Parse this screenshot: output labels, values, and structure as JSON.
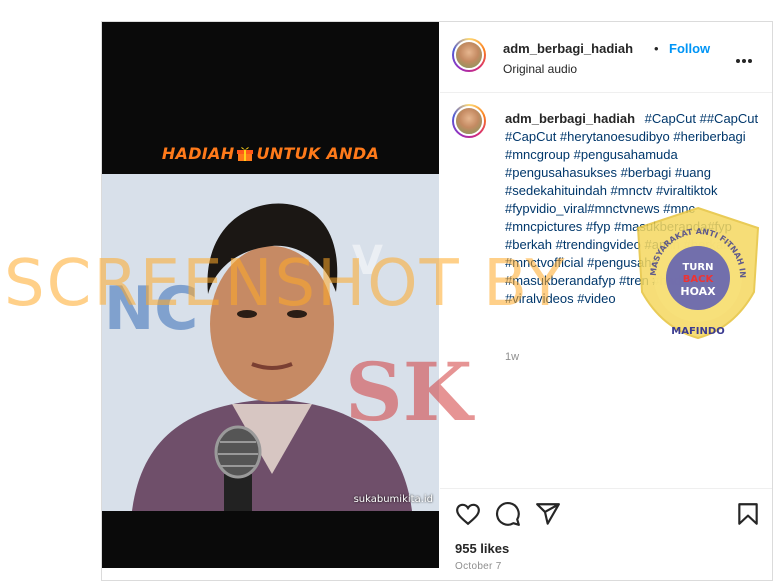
{
  "media": {
    "overlay_title_left": "HADIAH",
    "overlay_title_right": "UNTUK ANDA",
    "credit": "sukabumikita.id"
  },
  "watermarks": {
    "screenshot": "SCREENSHOT BY",
    "badge_top": "TURN",
    "badge_mid": "BACK",
    "badge_hoax": "HOAX",
    "badge_ring": "MASYARAKAT ANTI FITNAH INDONESIA",
    "badge_bottom": "MAFINDO",
    "sk": "SK"
  },
  "header": {
    "username": "adm_berbagi_hadiah",
    "separator": "•",
    "follow_label": "Follow",
    "subtitle": "Original audio"
  },
  "caption": {
    "username": "adm_berbagi_hadiah",
    "text": "#CapCut ##CapCut #CapCut #herytanoesudibyo #heriberbagi #mncgroup #pengusahamuda #pengusahasukses #berbagi #uang #sedekahituindah #mnctv #viraltiktok #fypvidio_viral#mnctvnews #mnc #mncpictures #fyp #masukberanda#fyp #berkah #trendingvideo #amin #berkah #mnctvofficial #pengusaha #masukberandafyp #tren #hadiah #viralvideos #video",
    "time": "1w"
  },
  "actions": {
    "icons": [
      "heart-icon",
      "comment-icon",
      "share-icon",
      "bookmark-icon"
    ]
  },
  "likes": "955 likes",
  "date": "October 7",
  "colors": {
    "follow": "#0095f6",
    "hashtag": "#00376b",
    "watermark": "#ffaa28",
    "overlay_title": "#ff7a1a"
  }
}
